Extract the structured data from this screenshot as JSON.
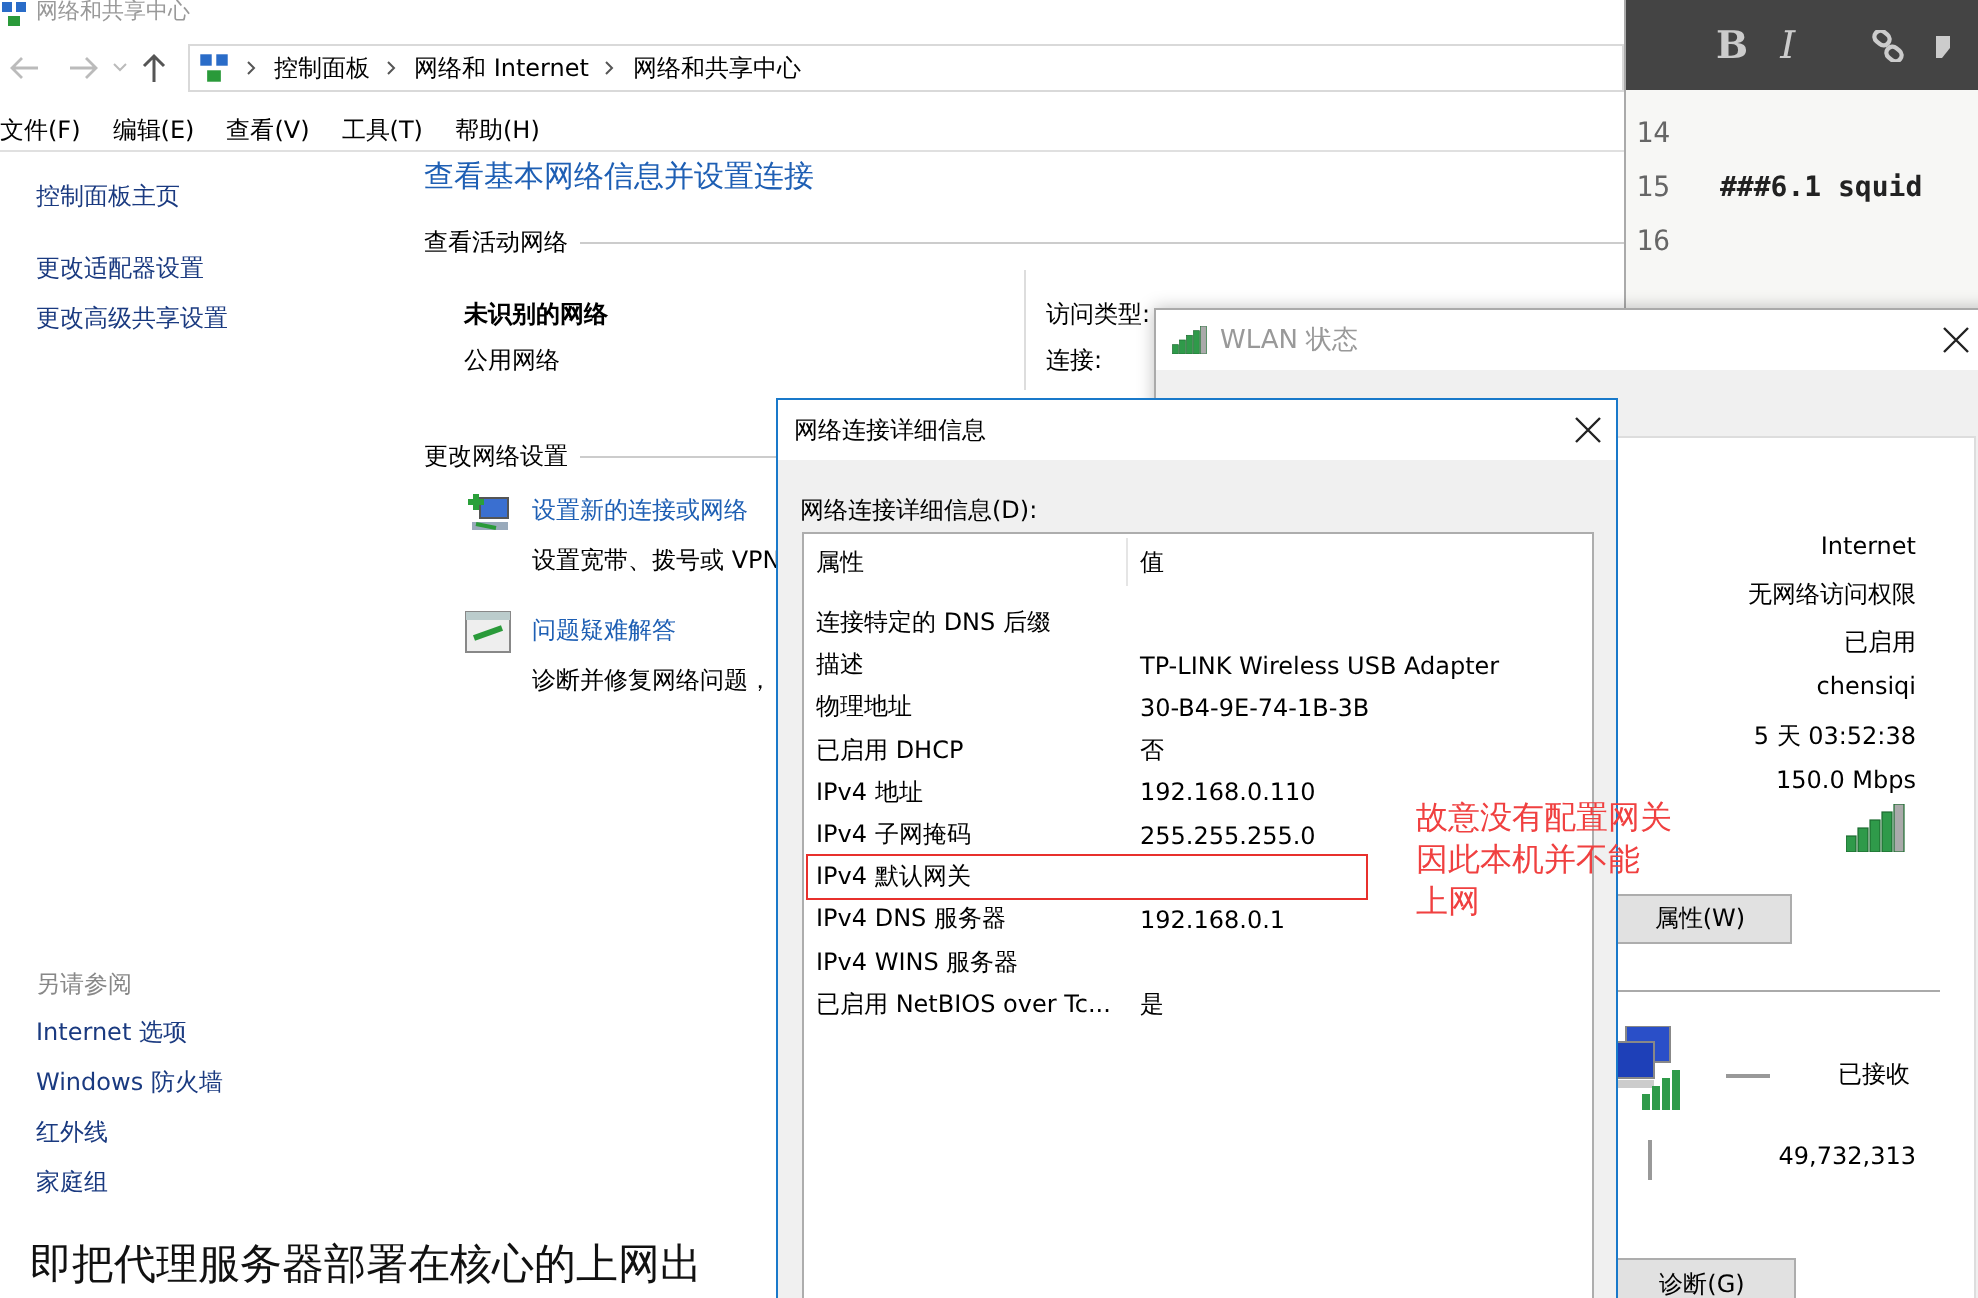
{
  "explorer": {
    "title": "网络和共享中心",
    "breadcrumb": [
      "控制面板",
      "网络和 Internet",
      "网络和共享中心"
    ],
    "menu": [
      "文件(F)",
      "编辑(E)",
      "查看(V)",
      "工具(T)",
      "帮助(H)"
    ],
    "sidebar": {
      "links": [
        "控制面板主页",
        "更改适配器设置",
        "更改高级共享设置"
      ],
      "see_also_heading": "另请参阅",
      "see_also": [
        "Internet 选项",
        "Windows 防火墙",
        "红外线",
        "家庭组"
      ]
    },
    "heading": "查看基本网络信息并设置连接",
    "active_networks_heading": "查看活动网络",
    "network": {
      "name": "未识别的网络",
      "type": "公用网络"
    },
    "access_labels": [
      "访问类型:",
      "连接:"
    ],
    "change_settings_heading": "更改网络设置",
    "tasks": [
      {
        "kind": "new-connection",
        "title": "设置新的连接或网络",
        "description": "设置宽带、拨号或 VPN"
      },
      {
        "kind": "troubleshoot",
        "title": "问题疑难解答",
        "description": "诊断并修复网络问题，"
      }
    ]
  },
  "document_behind": {
    "text": "即把代理服务器部署在核心的上网出"
  },
  "editor": {
    "toolbar": [
      "B",
      "I"
    ],
    "lines": [
      {
        "number": "14"
      },
      {
        "number": "15",
        "text": "###6.1 squid"
      },
      {
        "number": "16"
      }
    ]
  },
  "wlan_status": {
    "title": "WLAN 状态",
    "values": [
      "Internet",
      "无网络访问权限",
      "已启用",
      "chensiqi",
      "5 天 03:52:38",
      "150.0 Mbps"
    ],
    "properties_button": "属性(W)",
    "received_label": "已接收",
    "received_bytes": "49,732,313",
    "diagnose_button": "诊断(G)"
  },
  "details_dialog": {
    "title": "网络连接详细信息",
    "list_label": "网络连接详细信息(D):",
    "columns": [
      "属性",
      "值"
    ],
    "rows": [
      {
        "property": "连接特定的 DNS 后缀",
        "annotated": false
      },
      {
        "property": "描述",
        "value": "TP-LINK Wireless USB Adapter",
        "annotated": false
      },
      {
        "property": "物理地址",
        "value": "30-B4-9E-74-1B-3B",
        "annotated": false
      },
      {
        "property": "已启用 DHCP",
        "value": "否",
        "annotated": false
      },
      {
        "property": "IPv4 地址",
        "value": "192.168.0.110",
        "annotated": false
      },
      {
        "property": "IPv4 子网掩码",
        "value": "255.255.255.0",
        "annotated": false
      },
      {
        "property": "IPv4 默认网关",
        "annotated": true
      },
      {
        "property": "IPv4 DNS 服务器",
        "value": "192.168.0.1",
        "annotated": false
      },
      {
        "property": "IPv4 WINS 服务器",
        "annotated": false
      },
      {
        "property": "已启用 NetBIOS over Tc...",
        "value": "是",
        "annotated": false
      }
    ]
  },
  "annotation": {
    "note_lines": [
      "故意没有配置网关",
      "因此本机并不能",
      "上网"
    ]
  }
}
